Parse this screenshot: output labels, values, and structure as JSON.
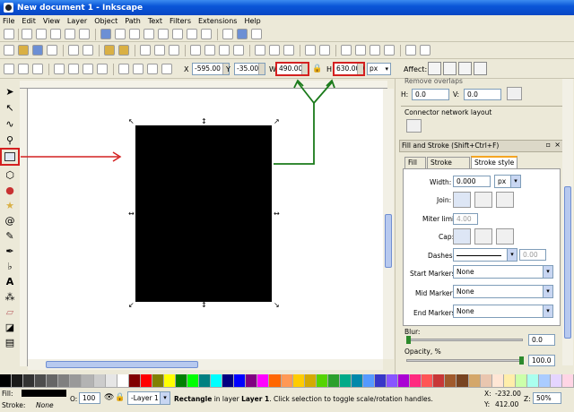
{
  "window": {
    "title": "New document 1 - Inkscape"
  },
  "menu": [
    "File",
    "Edit",
    "View",
    "Layer",
    "Object",
    "Path",
    "Text",
    "Filters",
    "Extensions",
    "Help"
  ],
  "selector_toolbar": {
    "x_label": "X",
    "x_value": "-595.00",
    "y_label": "Y",
    "y_value": "-35.000",
    "w_label": "W",
    "w_value": "490.000",
    "h_label": "H",
    "h_value": "630.000",
    "unit": "px",
    "affect_label": "Affect:"
  },
  "dock": {
    "remove_overlaps": "Remove overlaps",
    "h_label": "H:",
    "h_value": "0.0",
    "v_label": "V:",
    "v_value": "0.0",
    "connector_layout": "Connector network layout",
    "fill_stroke_title": "Fill and Stroke (Shift+Ctrl+F)",
    "tabs": [
      "Fill",
      "Stroke paint",
      "Stroke style"
    ],
    "width_label": "Width:",
    "width_value": "0.000",
    "width_unit": "px",
    "join_label": "Join:",
    "miter_label": "Miter limit:",
    "miter_value": "4.00",
    "cap_label": "Cap:",
    "dashes_label": "Dashes:",
    "dashes_value": "0.00",
    "start_markers_label": "Start Markers:",
    "start_markers_value": "None",
    "mid_markers_label": "Mid Markers:",
    "mid_markers_value": "None",
    "end_markers_label": "End Markers:",
    "end_markers_value": "None",
    "blur_label": "Blur:",
    "blur_value": "0.0",
    "opacity_label": "Opacity, %",
    "opacity_value": "100.0"
  },
  "status": {
    "fill_label": "Fill:",
    "stroke_label": "Stroke:",
    "stroke_value": "None",
    "opacity_label": "O:",
    "opacity_value": "100",
    "layer": "-Layer 1",
    "message_bold": "Rectangle",
    "message_rest": " in layer ",
    "message_layer": "Layer 1",
    "message_tail": ". Click selection to toggle scale/rotation handles.",
    "x_label": "X:",
    "x_value": "-232.00",
    "y_label": "Y:",
    "y_value": "412.00",
    "z_label": "Z:",
    "z_value": "50%"
  },
  "palette": [
    "#000000",
    "#1a1a1a",
    "#333333",
    "#4d4d4d",
    "#666666",
    "#808080",
    "#999999",
    "#b3b3b3",
    "#cccccc",
    "#e6e6e6",
    "#ffffff",
    "#800000",
    "#ff0000",
    "#808000",
    "#ffff00",
    "#008000",
    "#00ff00",
    "#008080",
    "#00ffff",
    "#000080",
    "#0000ff",
    "#800080",
    "#ff00ff",
    "#ff6600",
    "#ff9955",
    "#ffcc00",
    "#d4aa00",
    "#55d400",
    "#2ca02c",
    "#00aa88",
    "#0088aa",
    "#5599ff",
    "#3737c8",
    "#8855ff",
    "#aa00d4",
    "#ff2a7f",
    "#ff5555",
    "#c83737",
    "#a05a2c",
    "#784421",
    "#d4a76a",
    "#e9c6af",
    "#ffe6d5",
    "#ffeeaa",
    "#ccffaa",
    "#aaffee",
    "#aaccff",
    "#e5d5ff",
    "#ffd5e5"
  ]
}
